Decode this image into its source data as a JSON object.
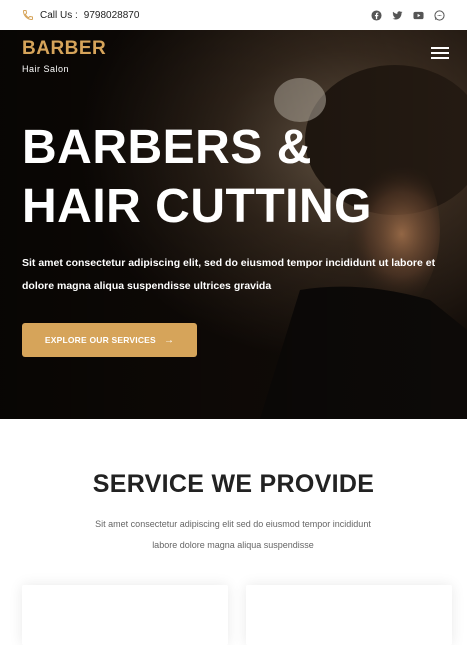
{
  "topbar": {
    "call_label": "Call Us :",
    "phone": "9798028870",
    "phone_icon": "phone-icon",
    "socials": [
      "facebook-icon",
      "twitter-icon",
      "youtube-icon",
      "whatsapp-icon"
    ]
  },
  "brand": {
    "name": "BARBER",
    "tagline": "Hair Salon"
  },
  "hero": {
    "title_line1": "BARBERS &",
    "title_line2": "HAIR CUTTING",
    "text": "Sit amet consectetur adipiscing elit, sed do eiusmod tempor incididunt ut labore et dolore magna aliqua suspendisse ultrices gravida",
    "button_label": "EXPLORE OUR SERVICES",
    "button_arrow": "→"
  },
  "services": {
    "title": "SERVICE WE PROVIDE",
    "text": "Sit amet consectetur adipiscing elit sed do eiusmod tempor incididunt labore dolore magna aliqua suspendisse"
  },
  "colors": {
    "accent": "#d6a45a",
    "dark": "#222222"
  }
}
